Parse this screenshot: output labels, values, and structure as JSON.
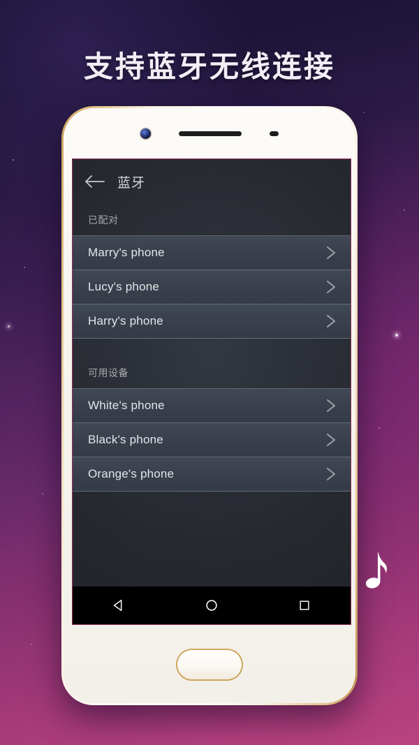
{
  "poster": {
    "headline": "支持蓝牙无线连接",
    "background_top_color": "#181233",
    "background_bottom_color": "#b8437f",
    "decoration_icon": "music-note-icon"
  },
  "phone": {
    "frame_color": "#ffffff",
    "bezel_accent_color": "#cfa65c",
    "screen_border_color": "#8e2f57",
    "hardware": {
      "front_camera": "front-camera-icon",
      "earpiece": "earpiece-speaker",
      "proximity_sensor": "proximity-sensor",
      "home_button": "home-button"
    }
  },
  "app": {
    "back_label": "←",
    "title": "蓝牙",
    "sections": [
      {
        "header": "已配对",
        "devices": [
          {
            "name": "Marry's phone",
            "chevron": "chevron-right-icon"
          },
          {
            "name": "Lucy's phone",
            "chevron": "chevron-right-icon"
          },
          {
            "name": "Harry's phone",
            "chevron": "chevron-right-icon"
          }
        ]
      },
      {
        "header": "可用设备",
        "devices": [
          {
            "name": "White's phone",
            "chevron": "chevron-right-icon"
          },
          {
            "name": "Black's phone",
            "chevron": "chevron-right-icon"
          },
          {
            "name": "Orange's phone",
            "chevron": "chevron-right-icon"
          }
        ]
      }
    ]
  },
  "navbar": {
    "back": "back-triangle-icon",
    "home": "home-circle-icon",
    "recents": "recents-square-icon"
  }
}
